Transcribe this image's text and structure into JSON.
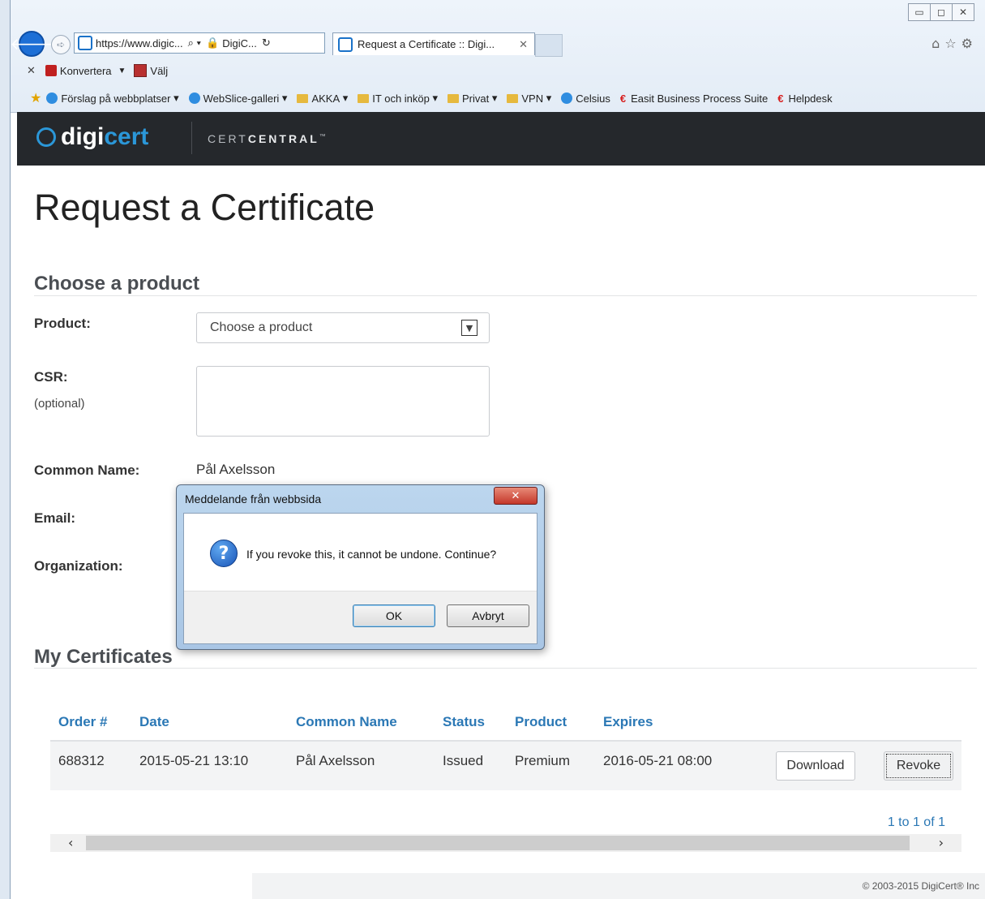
{
  "browser": {
    "address": "https://www.digic...",
    "address_site": "DigiC...",
    "tab_title": "Request a Certificate :: Digi...",
    "command_bar": {
      "convert": "Konvertera",
      "select": "Välj"
    },
    "favorites": [
      "Förslag på webbplatser",
      "WebSlice-galleri",
      "AKKA",
      "IT och inköp",
      "Privat",
      "VPN",
      "Celsius",
      "Easit Business Process Suite",
      "Helpdesk"
    ]
  },
  "brand": {
    "logo_prefix": "digi",
    "logo_suffix": "cert",
    "product_light": "CERT",
    "product_bold": "CENTRAL",
    "tm": "™"
  },
  "page": {
    "title": "Request a Certificate",
    "choose_section": "Choose a product",
    "product_label": "Product:",
    "product_select": "Choose a product",
    "csr_label": "CSR:",
    "csr_optional": "(optional)",
    "common_name_label": "Common Name:",
    "common_name_value": "Pål Axelsson",
    "email_label": "Email:",
    "organization_label": "Organization:",
    "certs_section": "My Certificates"
  },
  "table": {
    "columns": [
      "Order #",
      "Date",
      "Common Name",
      "Status",
      "Product",
      "Expires"
    ],
    "rows": [
      {
        "order": "688312",
        "date": "2015-05-21 13:10",
        "common_name": "Pål Axelsson",
        "status": "Issued",
        "product": "Premium",
        "expires": "2016-05-21 08:00"
      }
    ],
    "download_label": "Download",
    "revoke_label": "Revoke",
    "pager": "1 to 1 of 1"
  },
  "footer": "© 2003-2015 DigiCert® Inc",
  "dialog": {
    "title": "Meddelande från webbsida",
    "message": "If you revoke this, it cannot be undone. Continue?",
    "ok_label": "OK",
    "cancel_label": "Avbryt"
  }
}
